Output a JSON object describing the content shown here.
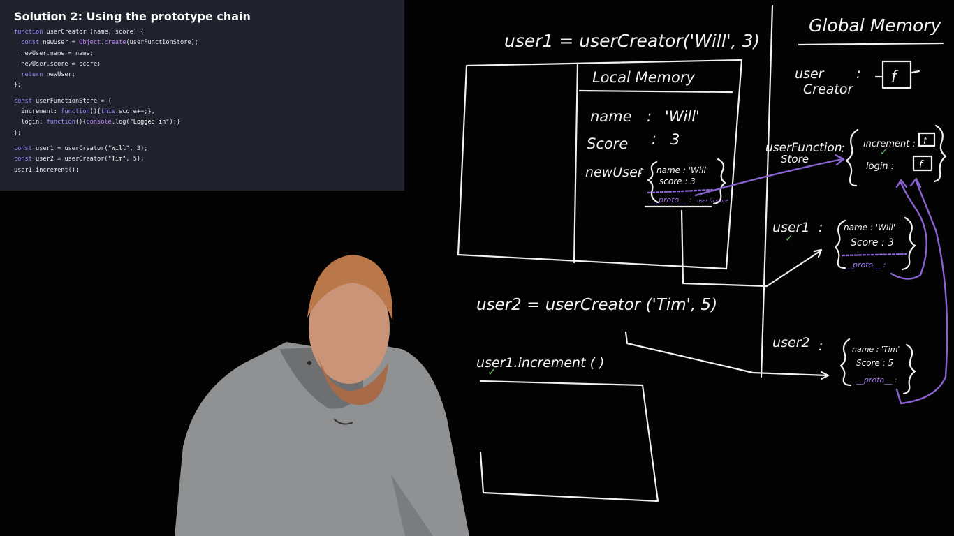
{
  "slide": {
    "title": "Solution 2: Using the prototype chain",
    "code": [
      [
        [
          "kw",
          "function "
        ],
        [
          "fn",
          "userCreator (name, score) {"
        ]
      ],
      [
        [
          "fn",
          "  "
        ],
        [
          "kw",
          "const "
        ],
        [
          "fn",
          "newUser = "
        ],
        [
          "bi",
          "Object"
        ],
        [
          "fn",
          "."
        ],
        [
          "bi",
          "create"
        ],
        [
          "fn",
          "(userFunctionStore);"
        ]
      ],
      [
        [
          "fn",
          "  newUser.name = name;"
        ]
      ],
      [
        [
          "fn",
          "  newUser.score = score;"
        ]
      ],
      [
        [
          "fn",
          "  "
        ],
        [
          "kw",
          "return "
        ],
        [
          "fn",
          "newUser;"
        ]
      ],
      [
        [
          "fn",
          "};"
        ]
      ],
      [],
      [
        [
          "kw",
          "const "
        ],
        [
          "fn",
          "userFunctionStore = {"
        ]
      ],
      [
        [
          "fn",
          "  increment: "
        ],
        [
          "kw",
          "function"
        ],
        [
          "fn",
          "(){"
        ],
        [
          "kw",
          "this"
        ],
        [
          "fn",
          ".score++;},"
        ]
      ],
      [
        [
          "fn",
          "  login: "
        ],
        [
          "kw",
          "function"
        ],
        [
          "fn",
          "(){"
        ],
        [
          "bi",
          "console"
        ],
        [
          "fn",
          ".log("
        ],
        [
          "str",
          "\"Logged in\""
        ],
        [
          "fn",
          ");}"
        ]
      ],
      [
        [
          "fn",
          "};"
        ]
      ],
      [],
      [
        [
          "kw",
          "const "
        ],
        [
          "fn",
          "user1 = userCreator("
        ],
        [
          "str",
          "\"Will\""
        ],
        [
          "fn",
          ", 3);"
        ]
      ],
      [
        [
          "kw",
          "const "
        ],
        [
          "fn",
          "user2 = userCreator("
        ],
        [
          "str",
          "\"Tim\""
        ],
        [
          "fn",
          ", 5);"
        ]
      ],
      [
        [
          "fn",
          "user1.increment();"
        ]
      ]
    ]
  },
  "board": {
    "call1": "user1 = userCreator('Will', 3)",
    "local_memory_title": "Local Memory",
    "local": {
      "name_key": "name",
      "name_val": "'Will'",
      "score_key": "Score",
      "score_val": "3",
      "newuser_key": "newUser",
      "obj_name": "name : 'Will'",
      "obj_score": "score : 3",
      "obj_proto": "__proto__ :",
      "obj_proto_note": "user fn store"
    },
    "global_memory_title": "Global Memory",
    "global": {
      "usercreator_key_1": "user",
      "usercreator_key_2": "Creator",
      "f_label": "f",
      "store_key_1": "userFunction",
      "store_key_2": "Store",
      "increment_key": "increment :",
      "login_key": "login :",
      "user1_key": "user1",
      "user1_name": "name : 'Will'",
      "user1_score": "Score : 3",
      "user1_proto": "__proto__ :",
      "user2_key": "user2",
      "user2_name": "name : 'Tim'",
      "user2_score": "Score : 5",
      "user2_proto": "__proto__ :"
    },
    "call2": "user2 = userCreator ('Tim', 5)",
    "call3": "user1.increment ( )",
    "colon": ":",
    "check": "✓"
  }
}
